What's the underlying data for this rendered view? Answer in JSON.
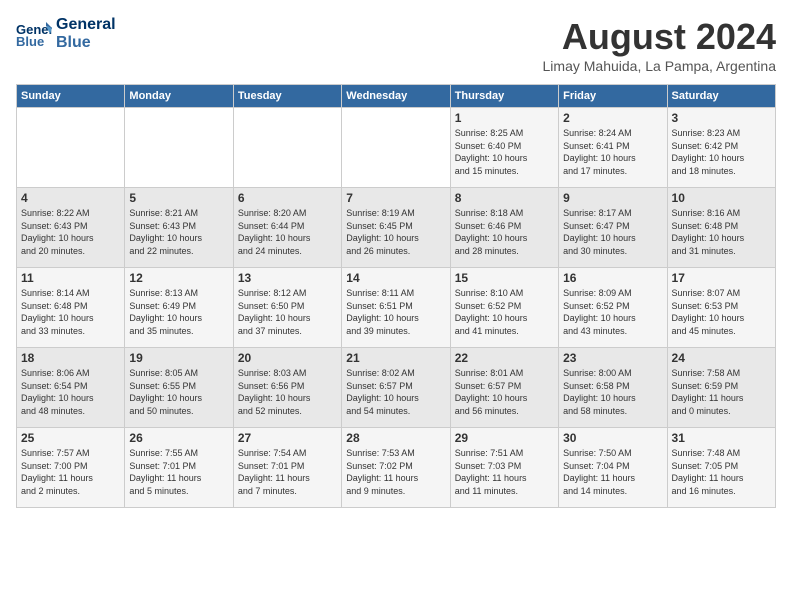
{
  "header": {
    "logo_line1": "General",
    "logo_line2": "Blue",
    "month_year": "August 2024",
    "location": "Limay Mahuida, La Pampa, Argentina"
  },
  "weekdays": [
    "Sunday",
    "Monday",
    "Tuesday",
    "Wednesday",
    "Thursday",
    "Friday",
    "Saturday"
  ],
  "weeks": [
    [
      {
        "day": "",
        "info": ""
      },
      {
        "day": "",
        "info": ""
      },
      {
        "day": "",
        "info": ""
      },
      {
        "day": "",
        "info": ""
      },
      {
        "day": "1",
        "info": "Sunrise: 8:25 AM\nSunset: 6:40 PM\nDaylight: 10 hours\nand 15 minutes."
      },
      {
        "day": "2",
        "info": "Sunrise: 8:24 AM\nSunset: 6:41 PM\nDaylight: 10 hours\nand 17 minutes."
      },
      {
        "day": "3",
        "info": "Sunrise: 8:23 AM\nSunset: 6:42 PM\nDaylight: 10 hours\nand 18 minutes."
      }
    ],
    [
      {
        "day": "4",
        "info": "Sunrise: 8:22 AM\nSunset: 6:43 PM\nDaylight: 10 hours\nand 20 minutes."
      },
      {
        "day": "5",
        "info": "Sunrise: 8:21 AM\nSunset: 6:43 PM\nDaylight: 10 hours\nand 22 minutes."
      },
      {
        "day": "6",
        "info": "Sunrise: 8:20 AM\nSunset: 6:44 PM\nDaylight: 10 hours\nand 24 minutes."
      },
      {
        "day": "7",
        "info": "Sunrise: 8:19 AM\nSunset: 6:45 PM\nDaylight: 10 hours\nand 26 minutes."
      },
      {
        "day": "8",
        "info": "Sunrise: 8:18 AM\nSunset: 6:46 PM\nDaylight: 10 hours\nand 28 minutes."
      },
      {
        "day": "9",
        "info": "Sunrise: 8:17 AM\nSunset: 6:47 PM\nDaylight: 10 hours\nand 30 minutes."
      },
      {
        "day": "10",
        "info": "Sunrise: 8:16 AM\nSunset: 6:48 PM\nDaylight: 10 hours\nand 31 minutes."
      }
    ],
    [
      {
        "day": "11",
        "info": "Sunrise: 8:14 AM\nSunset: 6:48 PM\nDaylight: 10 hours\nand 33 minutes."
      },
      {
        "day": "12",
        "info": "Sunrise: 8:13 AM\nSunset: 6:49 PM\nDaylight: 10 hours\nand 35 minutes."
      },
      {
        "day": "13",
        "info": "Sunrise: 8:12 AM\nSunset: 6:50 PM\nDaylight: 10 hours\nand 37 minutes."
      },
      {
        "day": "14",
        "info": "Sunrise: 8:11 AM\nSunset: 6:51 PM\nDaylight: 10 hours\nand 39 minutes."
      },
      {
        "day": "15",
        "info": "Sunrise: 8:10 AM\nSunset: 6:52 PM\nDaylight: 10 hours\nand 41 minutes."
      },
      {
        "day": "16",
        "info": "Sunrise: 8:09 AM\nSunset: 6:52 PM\nDaylight: 10 hours\nand 43 minutes."
      },
      {
        "day": "17",
        "info": "Sunrise: 8:07 AM\nSunset: 6:53 PM\nDaylight: 10 hours\nand 45 minutes."
      }
    ],
    [
      {
        "day": "18",
        "info": "Sunrise: 8:06 AM\nSunset: 6:54 PM\nDaylight: 10 hours\nand 48 minutes."
      },
      {
        "day": "19",
        "info": "Sunrise: 8:05 AM\nSunset: 6:55 PM\nDaylight: 10 hours\nand 50 minutes."
      },
      {
        "day": "20",
        "info": "Sunrise: 8:03 AM\nSunset: 6:56 PM\nDaylight: 10 hours\nand 52 minutes."
      },
      {
        "day": "21",
        "info": "Sunrise: 8:02 AM\nSunset: 6:57 PM\nDaylight: 10 hours\nand 54 minutes."
      },
      {
        "day": "22",
        "info": "Sunrise: 8:01 AM\nSunset: 6:57 PM\nDaylight: 10 hours\nand 56 minutes."
      },
      {
        "day": "23",
        "info": "Sunrise: 8:00 AM\nSunset: 6:58 PM\nDaylight: 10 hours\nand 58 minutes."
      },
      {
        "day": "24",
        "info": "Sunrise: 7:58 AM\nSunset: 6:59 PM\nDaylight: 11 hours\nand 0 minutes."
      }
    ],
    [
      {
        "day": "25",
        "info": "Sunrise: 7:57 AM\nSunset: 7:00 PM\nDaylight: 11 hours\nand 2 minutes."
      },
      {
        "day": "26",
        "info": "Sunrise: 7:55 AM\nSunset: 7:01 PM\nDaylight: 11 hours\nand 5 minutes."
      },
      {
        "day": "27",
        "info": "Sunrise: 7:54 AM\nSunset: 7:01 PM\nDaylight: 11 hours\nand 7 minutes."
      },
      {
        "day": "28",
        "info": "Sunrise: 7:53 AM\nSunset: 7:02 PM\nDaylight: 11 hours\nand 9 minutes."
      },
      {
        "day": "29",
        "info": "Sunrise: 7:51 AM\nSunset: 7:03 PM\nDaylight: 11 hours\nand 11 minutes."
      },
      {
        "day": "30",
        "info": "Sunrise: 7:50 AM\nSunset: 7:04 PM\nDaylight: 11 hours\nand 14 minutes."
      },
      {
        "day": "31",
        "info": "Sunrise: 7:48 AM\nSunset: 7:05 PM\nDaylight: 11 hours\nand 16 minutes."
      }
    ]
  ]
}
